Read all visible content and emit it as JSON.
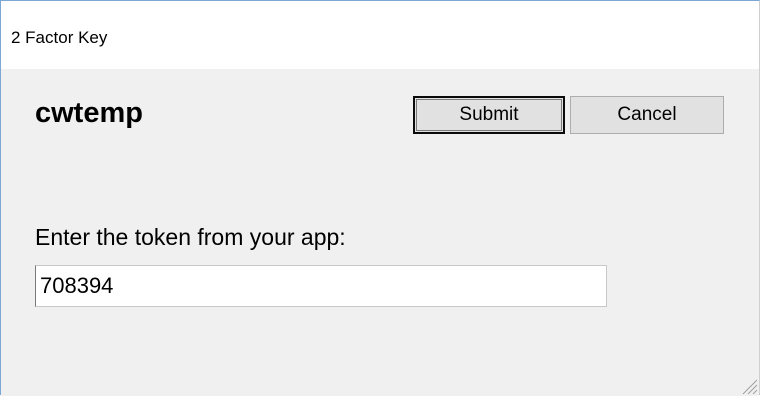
{
  "window": {
    "title": "2 Factor Key"
  },
  "main": {
    "username": "cwtemp",
    "submit_label": "Submit",
    "cancel_label": "Cancel",
    "prompt": "Enter the token from your app:",
    "token_value": "708394"
  },
  "icons": {
    "resize_grip": "resize-grip-icon"
  },
  "colors": {
    "window_border": "#7aa7d6",
    "background": "#f0f0f0",
    "button_face": "#e1e1e1"
  }
}
